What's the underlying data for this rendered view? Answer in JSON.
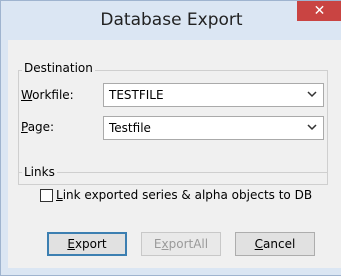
{
  "window": {
    "title": "Database Export",
    "close_glyph": "✕"
  },
  "destination": {
    "group_label": "Destination",
    "workfile": {
      "label_mnemonic": "W",
      "label_rest": "orkfile:",
      "value": "TESTFILE"
    },
    "page": {
      "label_mnemonic": "P",
      "label_rest": "age:",
      "value": "Testfile"
    }
  },
  "links": {
    "group_label": "Links",
    "checkbox": {
      "label_mnemonic": "L",
      "label_rest": "ink exported series & alpha objects to DB",
      "checked": false
    }
  },
  "buttons": {
    "export": {
      "mnemonic": "E",
      "rest": "xport"
    },
    "export_all": {
      "pre": "E",
      "mnemonic": "x",
      "rest": "portAll",
      "enabled": false
    },
    "cancel": {
      "mnemonic": "C",
      "rest": "ancel"
    }
  },
  "colors": {
    "close_button": "#c94442",
    "title_bar": "#dbe6f3",
    "default_button_border": "#3c7fb1"
  }
}
